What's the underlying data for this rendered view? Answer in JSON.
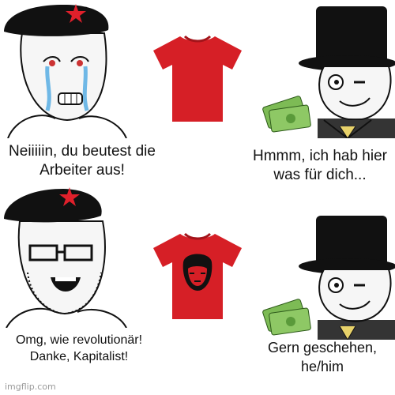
{
  "panels": {
    "top": {
      "left_caption": "Neiiiiin, du beutest die Arbeiter aus!",
      "right_caption": "Hmmm, ich hab hier was für dich..."
    },
    "bottom": {
      "left_caption": "Omg, wie revolutionär! Danke, Kapitalist!",
      "right_caption": "Gern geschehen, he/him"
    }
  },
  "watermark": "imgflip.com",
  "colors": {
    "shirt_red": "#d61f26",
    "hat_black": "#111111",
    "star_red": "#e0202b",
    "money_green": "#7dbb55"
  },
  "icons": [
    "hammer-sickle-icon",
    "money-icon",
    "top-hat-icon",
    "tshirt-icon"
  ]
}
